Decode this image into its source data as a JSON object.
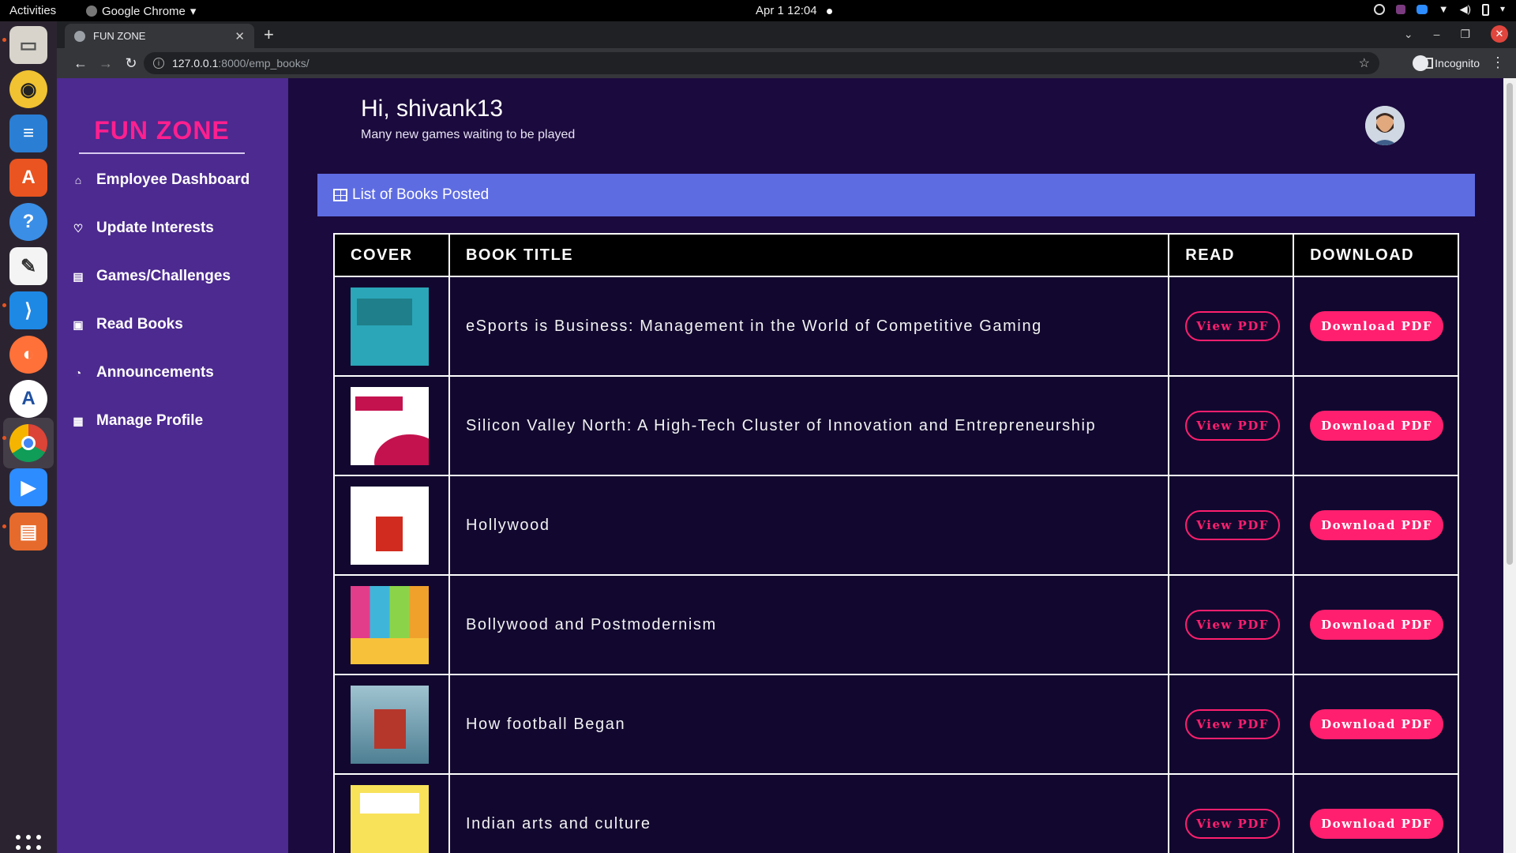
{
  "os": {
    "activities": "Activities",
    "app_name": "Google Chrome",
    "clock": "Apr 1  12:04"
  },
  "browser": {
    "tab_title": "FUN ZONE",
    "url_host": "127.0.0.1",
    "url_rest": ":8000/emp_books/",
    "profile": "Incognito"
  },
  "sidebar": {
    "brand": "FUN ZONE",
    "items": [
      {
        "label": "Employee Dashboard",
        "icon": "home-icon"
      },
      {
        "label": "Update Interests",
        "icon": "heart-icon"
      },
      {
        "label": "Games/Challenges",
        "icon": "chat-icon"
      },
      {
        "label": "Read Books",
        "icon": "book-icon"
      },
      {
        "label": "Announcements",
        "icon": "bell-icon"
      },
      {
        "label": "Manage Profile",
        "icon": "profile-card-icon"
      }
    ]
  },
  "header": {
    "greeting": "Hi, shivank13",
    "subtitle": "Many new games waiting to be played"
  },
  "panel": {
    "title": "List of Books Posted"
  },
  "table": {
    "columns": [
      "COVER",
      "BOOK TITLE",
      "READ",
      "DOWNLOAD"
    ],
    "read_label": "View PDF",
    "download_label": "Download PDF",
    "rows": [
      {
        "title": "eSports is Business: Management in the World of Competitive Gaming",
        "cover_color": "#2aa6b8"
      },
      {
        "title": "Silicon Valley North: A High-Tech Cluster of Innovation and Entrepreneurship",
        "cover_color": "#ffffff"
      },
      {
        "title": "Hollywood",
        "cover_color": "#ffffff"
      },
      {
        "title": "Bollywood and Postmodernism",
        "cover_color": "#f7c23a"
      },
      {
        "title": "How football Began",
        "cover_color": "#6e9cb0"
      },
      {
        "title": "Indian arts and culture",
        "cover_color": "#f8e25a"
      }
    ]
  },
  "colors": {
    "accent": "#ff1f6e",
    "brand": "#ff1f8e",
    "sidebar": "#4c2a8f",
    "panel_header": "#5e6ce2",
    "background": "#1b0a3d"
  }
}
